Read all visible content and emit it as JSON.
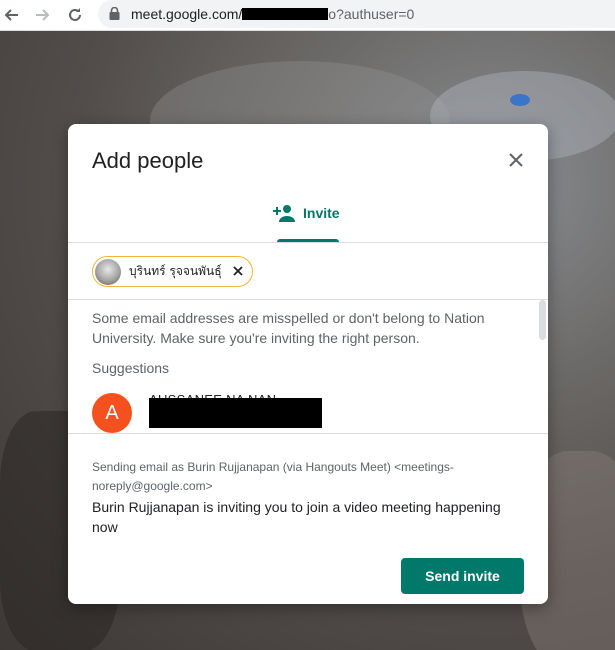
{
  "browser": {
    "url_prefix": "meet.google.com/",
    "url_suffix": "o?authuser=0"
  },
  "dialog": {
    "title": "Add people",
    "tab_label": "Invite",
    "chip_name": "บุรินทร์ รุจจนพันธุ์",
    "warning": "Some email addresses are misspelled or don't belong to Nation University. Make sure you're inviting the right person.",
    "suggestions_heading": "Suggestions",
    "suggestion": {
      "initial": "A",
      "name": "AUSSANEE NA NAN"
    },
    "sender_note": "Sending email as Burin Rujjanapan (via Hangouts Meet) <meetings-noreply@google.com>",
    "message": "Burin Rujjanapan is inviting you to join a video meeting happening now",
    "send_label": "Send invite"
  },
  "colors": {
    "accent": "#00796b",
    "chip_border": "#f2b632",
    "avatar_bg": "#f4511e"
  },
  "icons": [
    "back-arrow-icon",
    "forward-arrow-icon",
    "reload-icon",
    "lock-icon",
    "close-icon",
    "person-add-icon",
    "chip-close-icon"
  ]
}
